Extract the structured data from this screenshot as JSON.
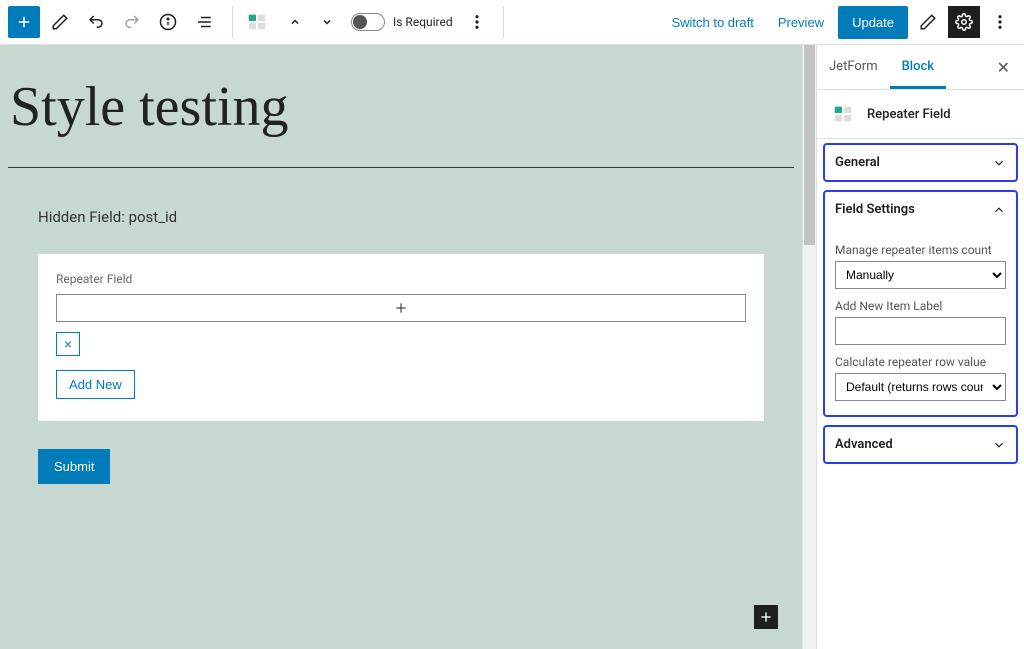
{
  "toolbar": {
    "toggle_label": "Is Required",
    "switch_draft_label": "Switch to draft",
    "preview_label": "Preview",
    "update_label": "Update"
  },
  "editor": {
    "page_title": "Style testing",
    "hidden_field_label": "Hidden Field: post_id",
    "repeater": {
      "label": "Repeater Field",
      "remove_glyph": "×",
      "add_new_label": "Add New"
    },
    "submit_label": "Submit"
  },
  "sidebar": {
    "tabs": {
      "jetform": "JetForm",
      "block": "Block"
    },
    "block_type": "Repeater Field",
    "panels": {
      "general": {
        "title": "General"
      },
      "field_settings": {
        "title": "Field Settings",
        "manage_label": "Manage repeater items count",
        "manage_value": "Manually",
        "add_item_label": "Add New Item Label",
        "add_item_value": "",
        "calc_label": "Calculate repeater row value",
        "calc_value": "Default (returns rows count)"
      },
      "advanced": {
        "title": "Advanced"
      }
    }
  }
}
